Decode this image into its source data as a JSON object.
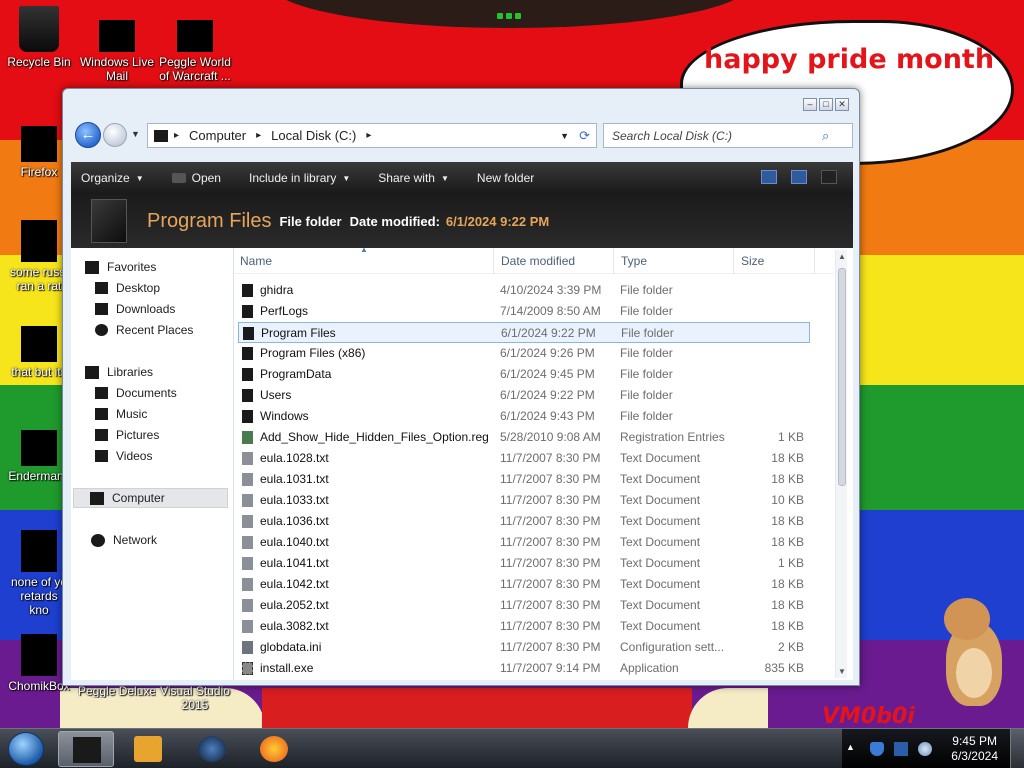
{
  "desktop": {
    "speech_text": "happy pride month",
    "watermark": "VM0b0i",
    "icons": [
      {
        "label": "Recycle Bin"
      },
      {
        "label": "Windows Live Mail"
      },
      {
        "label": "Peggle World of Warcraft ..."
      },
      {
        "label": "Firefox"
      },
      {
        "label": "some russi ran a rat"
      },
      {
        "label": "that but its"
      },
      {
        "label": "Endermanc"
      },
      {
        "label": "none of yo retards kno"
      },
      {
        "label": "ChomikBox"
      },
      {
        "label": "Peggle Deluxe"
      },
      {
        "label": "Visual Studio 2015"
      }
    ]
  },
  "window": {
    "breadcrumb": [
      "Computer",
      "Local Disk (C:)"
    ],
    "search_placeholder": "Search Local Disk (C:)",
    "toolbar": {
      "organize": "Organize",
      "open": "Open",
      "include_in_library": "Include in library",
      "share_with": "Share with",
      "new_folder": "New folder"
    },
    "details": {
      "title": "Program Files",
      "type": "File folder",
      "date_label": "Date modified:",
      "date_value": "6/1/2024 9:22 PM"
    },
    "nav": {
      "favorites": "Favorites",
      "desktop": "Desktop",
      "downloads": "Downloads",
      "recent_places": "Recent Places",
      "libraries": "Libraries",
      "documents": "Documents",
      "music": "Music",
      "pictures": "Pictures",
      "videos": "Videos",
      "computer": "Computer",
      "network": "Network"
    },
    "columns": {
      "name": "Name",
      "date": "Date modified",
      "type": "Type",
      "size": "Size"
    },
    "files": [
      {
        "name": "ghidra",
        "date": "4/10/2024 3:39 PM",
        "type": "File folder",
        "size": ""
      },
      {
        "name": "PerfLogs",
        "date": "7/14/2009 8:50 AM",
        "type": "File folder",
        "size": ""
      },
      {
        "name": "Program Files",
        "date": "6/1/2024 9:22 PM",
        "type": "File folder",
        "size": ""
      },
      {
        "name": "Program Files (x86)",
        "date": "6/1/2024 9:26 PM",
        "type": "File folder",
        "size": ""
      },
      {
        "name": "ProgramData",
        "date": "6/1/2024 9:45 PM",
        "type": "File folder",
        "size": ""
      },
      {
        "name": "Users",
        "date": "6/1/2024 9:22 PM",
        "type": "File folder",
        "size": ""
      },
      {
        "name": "Windows",
        "date": "6/1/2024 9:43 PM",
        "type": "File folder",
        "size": ""
      },
      {
        "name": "Add_Show_Hide_Hidden_Files_Option.reg",
        "date": "5/28/2010 9:08 AM",
        "type": "Registration Entries",
        "size": "1 KB"
      },
      {
        "name": "eula.1028.txt",
        "date": "11/7/2007 8:30 PM",
        "type": "Text Document",
        "size": "18 KB"
      },
      {
        "name": "eula.1031.txt",
        "date": "11/7/2007 8:30 PM",
        "type": "Text Document",
        "size": "18 KB"
      },
      {
        "name": "eula.1033.txt",
        "date": "11/7/2007 8:30 PM",
        "type": "Text Document",
        "size": "10 KB"
      },
      {
        "name": "eula.1036.txt",
        "date": "11/7/2007 8:30 PM",
        "type": "Text Document",
        "size": "18 KB"
      },
      {
        "name": "eula.1040.txt",
        "date": "11/7/2007 8:30 PM",
        "type": "Text Document",
        "size": "18 KB"
      },
      {
        "name": "eula.1041.txt",
        "date": "11/7/2007 8:30 PM",
        "type": "Text Document",
        "size": "1 KB"
      },
      {
        "name": "eula.1042.txt",
        "date": "11/7/2007 8:30 PM",
        "type": "Text Document",
        "size": "18 KB"
      },
      {
        "name": "eula.2052.txt",
        "date": "11/7/2007 8:30 PM",
        "type": "Text Document",
        "size": "18 KB"
      },
      {
        "name": "eula.3082.txt",
        "date": "11/7/2007 8:30 PM",
        "type": "Text Document",
        "size": "18 KB"
      },
      {
        "name": "globdata.ini",
        "date": "11/7/2007 8:30 PM",
        "type": "Configuration sett...",
        "size": "2 KB"
      },
      {
        "name": "install.exe",
        "date": "11/7/2007 9:14 PM",
        "type": "Application",
        "size": "835 KB"
      }
    ]
  },
  "taskbar": {
    "time": "9:45 PM",
    "date": "6/3/2024"
  }
}
